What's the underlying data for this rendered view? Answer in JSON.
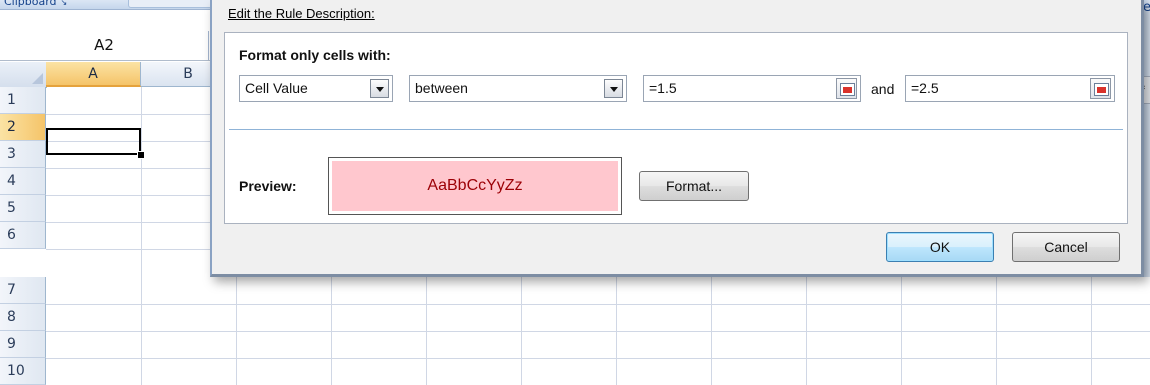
{
  "ribbon": {
    "clipboard_label": "Clipboard",
    "clipboard_launcher": "↘"
  },
  "formula_bar": {
    "name_box": "A2"
  },
  "sheet": {
    "columns": [
      "A",
      "B"
    ],
    "rows": [
      "1",
      "2",
      "3",
      "4",
      "5",
      "6",
      "7",
      "8",
      "9",
      "10"
    ],
    "selected_column": "A",
    "selected_row": "2",
    "active_cell": "A2"
  },
  "right_frame": {
    "edge_label": "e",
    "side_button": "‹"
  },
  "dialog": {
    "rule_description_label": "Edit the Rule Description:",
    "format_only_label": "Format only cells with:",
    "condition_type": "Cell Value",
    "operator": "between",
    "value1": "=1.5",
    "and_label": "and",
    "value2": "=2.5",
    "preview_label": "Preview:",
    "preview_sample": "AaBbCcYyZz",
    "format_button": "Format...",
    "ok_button": "OK",
    "cancel_button": "Cancel"
  },
  "colors": {
    "preview_fill": "#ffc7ce",
    "preview_text": "#9c0006",
    "header_highlight": "#f5c469",
    "ok_border": "#3c7fb1"
  }
}
